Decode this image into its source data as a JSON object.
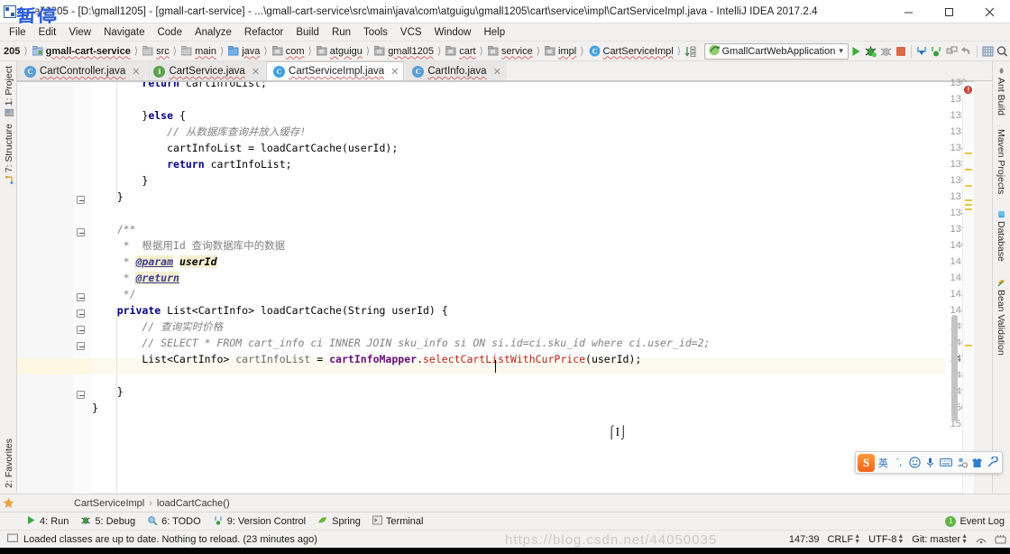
{
  "window": {
    "title": "gmall1205 - [D:\\gmall1205] - [gmall-cart-service] - ...\\gmall-cart-service\\src\\main\\java\\com\\atguigu\\gmall1205\\cart\\service\\impl\\CartServiceImpl.java - IntelliJ IDEA 2017.2.4",
    "watermark": "暂停",
    "minimize": "–",
    "maximize": "□",
    "close": "✕"
  },
  "menu": [
    "File",
    "Edit",
    "View",
    "Navigate",
    "Code",
    "Analyze",
    "Refactor",
    "Build",
    "Run",
    "Tools",
    "VCS",
    "Window",
    "Help"
  ],
  "navbar": {
    "prefix": "205",
    "crumbs": [
      {
        "label": "gmall-cart-service",
        "icon": "module-icon",
        "bold": true
      },
      {
        "label": "src",
        "icon": "folder-icon",
        "bold": false
      },
      {
        "label": "main",
        "icon": "folder-icon",
        "bold": false
      },
      {
        "label": "java",
        "icon": "source-folder-icon",
        "bold": false
      },
      {
        "label": "com",
        "icon": "package-icon",
        "bold": false
      },
      {
        "label": "atguigu",
        "icon": "package-icon",
        "bold": false
      },
      {
        "label": "gmall1205",
        "icon": "package-icon",
        "bold": false
      },
      {
        "label": "cart",
        "icon": "package-icon",
        "bold": false
      },
      {
        "label": "service",
        "icon": "package-icon",
        "bold": false
      },
      {
        "label": "impl",
        "icon": "package-icon",
        "bold": false
      },
      {
        "label": "CartServiceImpl",
        "icon": "class-icon",
        "bold": false
      }
    ],
    "run_configuration": "GmallCartWebApplication",
    "buttons": [
      {
        "name": "run-button",
        "glyph": "▶"
      },
      {
        "name": "debug-button",
        "glyph": "bug"
      },
      {
        "name": "run-with-coverage-button",
        "glyph": "coverage"
      },
      {
        "name": "stop-button",
        "glyph": "stop"
      },
      {
        "name": "update-project-button",
        "glyph": "vcs-update"
      },
      {
        "name": "commit-button",
        "glyph": "vcs-commit"
      },
      {
        "name": "push-button",
        "glyph": "vcs-push"
      },
      {
        "name": "undo-button",
        "glyph": "↺"
      },
      {
        "name": "settings-button",
        "glyph": "gear"
      },
      {
        "name": "search-everywhere-button",
        "glyph": "🔍"
      }
    ]
  },
  "editor_tabs": [
    {
      "label": "CartController.java",
      "kind": "C",
      "color": "#5a9ed4",
      "active": false
    },
    {
      "label": "CartService.java",
      "kind": "I",
      "color": "#5fa04e",
      "active": false
    },
    {
      "label": "CartServiceImpl.java",
      "kind": "C",
      "color": "#3f9fe0",
      "active": true
    },
    {
      "label": "CartInfo.java",
      "kind": "C",
      "color": "#5a9ed4",
      "active": false
    }
  ],
  "tool_windows": {
    "left": [
      {
        "label": "1: Project",
        "icon": "project-icon"
      },
      {
        "label": "7: Structure",
        "icon": "structure-icon"
      },
      {
        "label": "2: Favorites",
        "icon": "favorites-icon"
      }
    ],
    "right": [
      {
        "label": "Ant Build",
        "icon": "ant-icon"
      },
      {
        "label": "Maven Projects",
        "icon": "maven-icon"
      },
      {
        "label": "Database",
        "icon": "database-icon"
      },
      {
        "label": "Bean Validation",
        "icon": "bean-validation-icon"
      }
    ],
    "bottom": [
      {
        "label": "4: Run",
        "icon": "run-icon"
      },
      {
        "label": "5: Debug",
        "icon": "debug-icon"
      },
      {
        "label": "6: TODO",
        "icon": "todo-icon"
      },
      {
        "label": "9: Version Control",
        "icon": "vcs-icon"
      },
      {
        "label": "Spring",
        "icon": "spring-icon"
      },
      {
        "label": "Terminal",
        "icon": "terminal-icon"
      }
    ]
  },
  "code": {
    "first_line": 130,
    "caret_line": 147,
    "lines": [
      {
        "n": 130,
        "tokens": [
          {
            "t": "        ",
            "c": "pl"
          },
          {
            "t": "return",
            "c": "k"
          },
          {
            "t": " cartInfoList;",
            "c": "pl"
          }
        ],
        "clipped": true
      },
      {
        "n": 131,
        "tokens": []
      },
      {
        "n": 132,
        "tokens": [
          {
            "t": "        }",
            "c": "pl"
          },
          {
            "t": "else",
            "c": "k"
          },
          {
            "t": " {",
            "c": "pl"
          }
        ]
      },
      {
        "n": 133,
        "tokens": [
          {
            "t": "            // 从数据库查询并放入缓存!",
            "c": "cm"
          }
        ]
      },
      {
        "n": 134,
        "tokens": [
          {
            "t": "            cartInfoList = loadCartCache(userId);",
            "c": "pl"
          }
        ]
      },
      {
        "n": 135,
        "tokens": [
          {
            "t": "            ",
            "c": "pl"
          },
          {
            "t": "return",
            "c": "k"
          },
          {
            "t": " cartInfoList;",
            "c": "pl"
          }
        ]
      },
      {
        "n": 136,
        "tokens": [
          {
            "t": "        }",
            "c": "pl"
          }
        ]
      },
      {
        "n": 137,
        "tokens": [
          {
            "t": "    }",
            "c": "pl"
          }
        ]
      },
      {
        "n": 138,
        "tokens": []
      },
      {
        "n": 139,
        "tokens": [
          {
            "t": "    /**",
            "c": "jd"
          }
        ]
      },
      {
        "n": 140,
        "tokens": [
          {
            "t": "     *  根据用",
            "c": "jd"
          },
          {
            "t": "Id",
            "c": "jd"
          },
          {
            "t": " 查询数据库中的数据",
            "c": "jd"
          }
        ]
      },
      {
        "n": 141,
        "tokens": [
          {
            "t": "     * ",
            "c": "jd"
          },
          {
            "t": "@param",
            "c": "jdt"
          },
          {
            "t": " ",
            "c": "jd"
          },
          {
            "t": "userId",
            "c": "jdp"
          }
        ]
      },
      {
        "n": 142,
        "tokens": [
          {
            "t": "     * ",
            "c": "jd"
          },
          {
            "t": "@return",
            "c": "jdt"
          }
        ]
      },
      {
        "n": 143,
        "tokens": [
          {
            "t": "     */",
            "c": "jd"
          }
        ]
      },
      {
        "n": 144,
        "tokens": [
          {
            "t": "    ",
            "c": "pl"
          },
          {
            "t": "private",
            "c": "k"
          },
          {
            "t": " List<CartInfo> loadCartCache(String userId) {",
            "c": "pl"
          }
        ]
      },
      {
        "n": 145,
        "tokens": [
          {
            "t": "        // 查询实时价格",
            "c": "cm"
          }
        ]
      },
      {
        "n": 146,
        "tokens": [
          {
            "t": "        // SELECT * FROM cart_info ci INNER JOIN sku_info si ON si.id=ci.sku_id where ci.user_id=2;",
            "c": "cm"
          }
        ]
      },
      {
        "n": 147,
        "tokens": [
          {
            "t": "        List<CartInfo> ",
            "c": "pl"
          },
          {
            "t": "cartInfoList",
            "c": "param"
          },
          {
            "t": " = ",
            "c": "pl"
          },
          {
            "t": "cartInfoMapper",
            "c": "fld"
          },
          {
            "t": ".",
            "c": "pl"
          },
          {
            "t": "selectCartListWithCurPrice",
            "c": "mth"
          },
          {
            "t": "(userId);",
            "c": "pl"
          }
        ]
      },
      {
        "n": 148,
        "tokens": []
      },
      {
        "n": 149,
        "tokens": [
          {
            "t": "    }",
            "c": "pl"
          }
        ]
      },
      {
        "n": 150,
        "tokens": [
          {
            "t": "}",
            "c": "pl"
          }
        ]
      },
      {
        "n": 151,
        "tokens": []
      }
    ]
  },
  "breadcrumb": {
    "items": [
      "CartServiceImpl",
      "loadCartCache()"
    ],
    "separator": "›"
  },
  "status": {
    "message": "Loaded classes are up to date. Nothing to reload. (23 minutes ago)",
    "event_log": "Event Log",
    "event_count": "1",
    "caret_position": "147:39",
    "line_separator": "CRLF",
    "encoding": "UTF-8",
    "vcs_branch": "Git: master",
    "watermark": "https://blog.csdn.net/44050035"
  },
  "ime": {
    "logo": "S",
    "mode": "英",
    "items": [
      "punctuation-icon",
      "emoji-icon",
      "voice-icon",
      "soft-keyboard-icon",
      "user-icon",
      "skin-icon",
      "tools-icon"
    ]
  },
  "colors": {
    "accent_green": "#62b543",
    "error_red": "#d8453a",
    "warning_yellow": "#e8c547",
    "keyword_blue": "#000080",
    "comment_gray": "#808080",
    "field_purple": "#660e7a",
    "method_red": "#b3261e"
  }
}
